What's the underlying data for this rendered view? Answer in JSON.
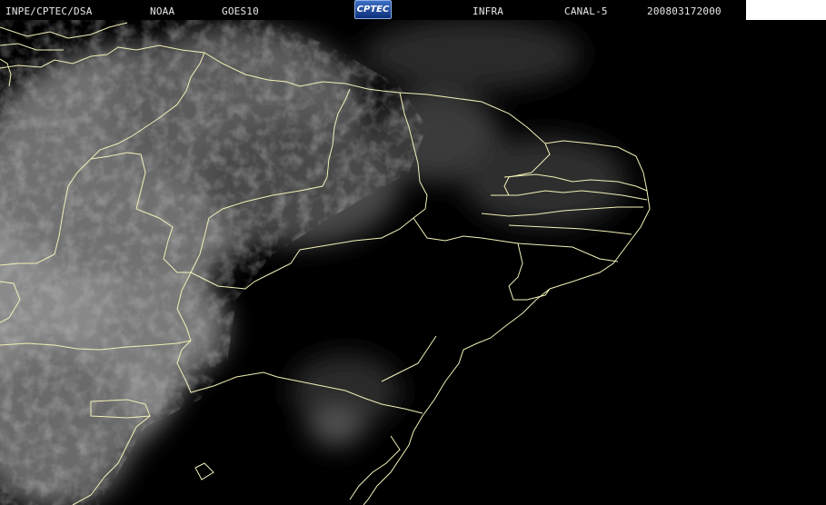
{
  "header": {
    "source": "INPE/CPTEC/DSA",
    "agency": "NOAA",
    "satellite": "GOES10",
    "logo_text": "CPTEC",
    "product": "INFRA",
    "channel": "CANAL-5",
    "timestamp": "200803172000"
  },
  "colors": {
    "background": "#000000",
    "border_lines": "#f2f0b8",
    "header_text": "#e8e8e8"
  }
}
